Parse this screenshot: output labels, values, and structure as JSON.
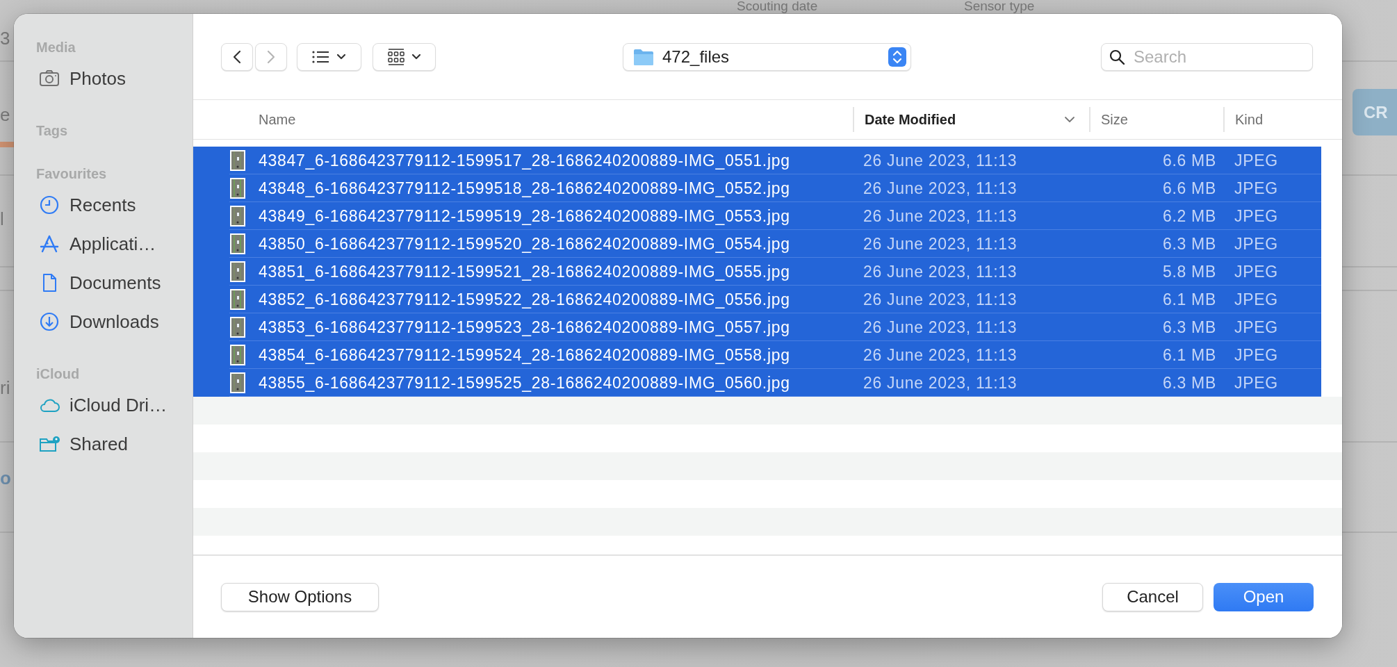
{
  "background": {
    "column_headers": [
      "Scouting date",
      "Sensor type"
    ],
    "fragments": [
      {
        "text": "3",
        "kind": "plain"
      },
      {
        "text": "e",
        "kind": "plain"
      },
      {
        "text": "l",
        "kind": "plain"
      },
      {
        "text": "ri",
        "kind": "plain"
      },
      {
        "text": "o",
        "kind": "link"
      }
    ],
    "button": "CR"
  },
  "sidebar": {
    "sections": [
      {
        "title": "Media",
        "items": [
          {
            "label": "Photos"
          }
        ]
      },
      {
        "title": "Tags"
      },
      {
        "title": "Favourites",
        "items": [
          {
            "label": "Recents"
          },
          {
            "label": "Applicati…"
          },
          {
            "label": "Documents"
          },
          {
            "label": "Downloads"
          }
        ]
      },
      {
        "title": "iCloud",
        "items": [
          {
            "label": "iCloud Dri…"
          },
          {
            "label": "Shared"
          }
        ]
      }
    ]
  },
  "toolbar": {
    "nav": [
      {
        "kind": "back",
        "disabled": false
      },
      {
        "kind": "forward",
        "disabled": true
      }
    ],
    "location": "472_files",
    "search": {
      "placeholder": "Search"
    }
  },
  "table": {
    "columns": [
      {
        "label": "Name",
        "sorted": false
      },
      {
        "label": "Date Modified",
        "sorted": true
      },
      {
        "label": "Size",
        "sorted": false
      },
      {
        "label": "Kind",
        "sorted": false
      }
    ],
    "rows": [
      {
        "name": "43847_6-1686423779112-1599517_28-1686240200889-IMG_0551.jpg",
        "date": "26 June 2023, 11:13",
        "size": "6.6 MB",
        "kind": "JPEG",
        "selected": true
      },
      {
        "name": "43848_6-1686423779112-1599518_28-1686240200889-IMG_0552.jpg",
        "date": "26 June 2023, 11:13",
        "size": "6.6 MB",
        "kind": "JPEG",
        "selected": true
      },
      {
        "name": "43849_6-1686423779112-1599519_28-1686240200889-IMG_0553.jpg",
        "date": "26 June 2023, 11:13",
        "size": "6.2 MB",
        "kind": "JPEG",
        "selected": true
      },
      {
        "name": "43850_6-1686423779112-1599520_28-1686240200889-IMG_0554.jpg",
        "date": "26 June 2023, 11:13",
        "size": "6.3 MB",
        "kind": "JPEG",
        "selected": true
      },
      {
        "name": "43851_6-1686423779112-1599521_28-1686240200889-IMG_0555.jpg",
        "date": "26 June 2023, 11:13",
        "size": "5.8 MB",
        "kind": "JPEG",
        "selected": true
      },
      {
        "name": "43852_6-1686423779112-1599522_28-1686240200889-IMG_0556.jpg",
        "date": "26 June 2023, 11:13",
        "size": "6.1 MB",
        "kind": "JPEG",
        "selected": true
      },
      {
        "name": "43853_6-1686423779112-1599523_28-1686240200889-IMG_0557.jpg",
        "date": "26 June 2023, 11:13",
        "size": "6.3 MB",
        "kind": "JPEG",
        "selected": true
      },
      {
        "name": "43854_6-1686423779112-1599524_28-1686240200889-IMG_0558.jpg",
        "date": "26 June 2023, 11:13",
        "size": "6.1 MB",
        "kind": "JPEG",
        "selected": true
      },
      {
        "name": "43855_6-1686423779112-1599525_28-1686240200889-IMG_0560.jpg",
        "date": "26 June 2023, 11:13",
        "size": "6.3 MB",
        "kind": "JPEG",
        "selected": true
      }
    ]
  },
  "buttons": [
    {
      "label": "Show Options",
      "kind": "plain"
    },
    {
      "label": "Cancel",
      "kind": "plain"
    },
    {
      "label": "Open",
      "kind": "primary"
    }
  ]
}
